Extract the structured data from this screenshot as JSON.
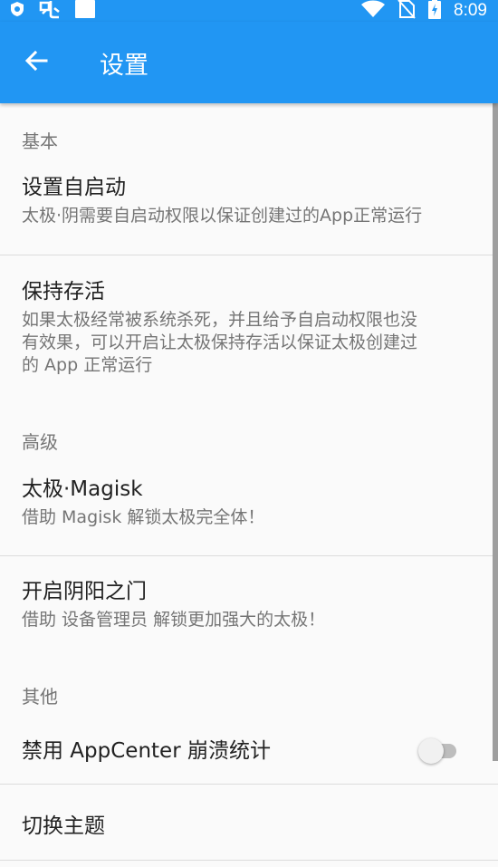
{
  "status_bar": {
    "time": "8:09",
    "icons": [
      "shield-icon",
      "app-logo-icon",
      "square-notification-icon",
      "wifi-icon",
      "no-sim-icon",
      "battery-charging-icon"
    ]
  },
  "app_bar": {
    "title": "设置",
    "back_icon": "arrow-back-icon",
    "color": "#2196f3"
  },
  "sections": {
    "basic": {
      "header": "基本",
      "autostart": {
        "title": "设置自启动",
        "summary": "太极·阴需要自启动权限以保证创建过的App正常运行"
      },
      "keep_alive": {
        "title": "保持存活",
        "summary_line1": "如果太极经常被系统杀死，并且给予自启动权限也没",
        "summary_line2": "有效果，可以开启让太极保持存活以保证太极创建过",
        "summary_line3": "的 App 正常运行"
      }
    },
    "advanced": {
      "header": "高级",
      "magisk": {
        "title": "太极·Magisk",
        "summary": "借助 Magisk 解锁太极完全体！"
      },
      "yinyang": {
        "title": "开启阴阳之门",
        "summary": "借助 设备管理员 解锁更加强大的太极！"
      }
    },
    "other": {
      "header": "其他",
      "appcenter": {
        "title": "禁用 AppCenter 崩溃统计",
        "enabled": false
      },
      "theme": {
        "title": "切换主题"
      }
    }
  }
}
